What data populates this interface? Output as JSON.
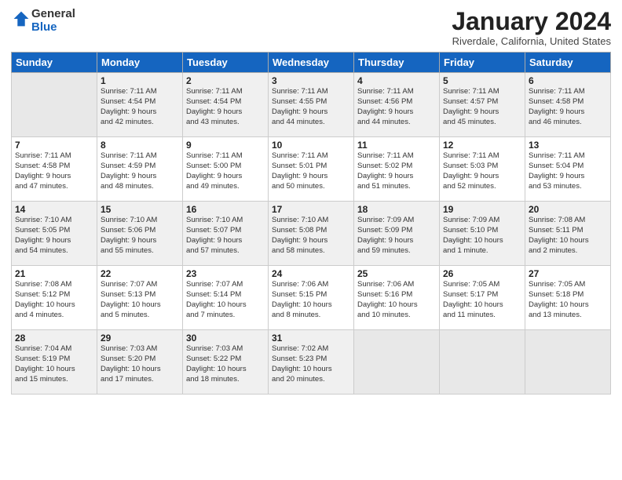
{
  "logo": {
    "text_general": "General",
    "text_blue": "Blue"
  },
  "header": {
    "month": "January 2024",
    "location": "Riverdale, California, United States"
  },
  "weekdays": [
    "Sunday",
    "Monday",
    "Tuesday",
    "Wednesday",
    "Thursday",
    "Friday",
    "Saturday"
  ],
  "weeks": [
    [
      {
        "day": "",
        "info": ""
      },
      {
        "day": "1",
        "info": "Sunrise: 7:11 AM\nSunset: 4:54 PM\nDaylight: 9 hours\nand 42 minutes."
      },
      {
        "day": "2",
        "info": "Sunrise: 7:11 AM\nSunset: 4:54 PM\nDaylight: 9 hours\nand 43 minutes."
      },
      {
        "day": "3",
        "info": "Sunrise: 7:11 AM\nSunset: 4:55 PM\nDaylight: 9 hours\nand 44 minutes."
      },
      {
        "day": "4",
        "info": "Sunrise: 7:11 AM\nSunset: 4:56 PM\nDaylight: 9 hours\nand 44 minutes."
      },
      {
        "day": "5",
        "info": "Sunrise: 7:11 AM\nSunset: 4:57 PM\nDaylight: 9 hours\nand 45 minutes."
      },
      {
        "day": "6",
        "info": "Sunrise: 7:11 AM\nSunset: 4:58 PM\nDaylight: 9 hours\nand 46 minutes."
      }
    ],
    [
      {
        "day": "7",
        "info": "Sunrise: 7:11 AM\nSunset: 4:58 PM\nDaylight: 9 hours\nand 47 minutes."
      },
      {
        "day": "8",
        "info": "Sunrise: 7:11 AM\nSunset: 4:59 PM\nDaylight: 9 hours\nand 48 minutes."
      },
      {
        "day": "9",
        "info": "Sunrise: 7:11 AM\nSunset: 5:00 PM\nDaylight: 9 hours\nand 49 minutes."
      },
      {
        "day": "10",
        "info": "Sunrise: 7:11 AM\nSunset: 5:01 PM\nDaylight: 9 hours\nand 50 minutes."
      },
      {
        "day": "11",
        "info": "Sunrise: 7:11 AM\nSunset: 5:02 PM\nDaylight: 9 hours\nand 51 minutes."
      },
      {
        "day": "12",
        "info": "Sunrise: 7:11 AM\nSunset: 5:03 PM\nDaylight: 9 hours\nand 52 minutes."
      },
      {
        "day": "13",
        "info": "Sunrise: 7:11 AM\nSunset: 5:04 PM\nDaylight: 9 hours\nand 53 minutes."
      }
    ],
    [
      {
        "day": "14",
        "info": "Sunrise: 7:10 AM\nSunset: 5:05 PM\nDaylight: 9 hours\nand 54 minutes."
      },
      {
        "day": "15",
        "info": "Sunrise: 7:10 AM\nSunset: 5:06 PM\nDaylight: 9 hours\nand 55 minutes."
      },
      {
        "day": "16",
        "info": "Sunrise: 7:10 AM\nSunset: 5:07 PM\nDaylight: 9 hours\nand 57 minutes."
      },
      {
        "day": "17",
        "info": "Sunrise: 7:10 AM\nSunset: 5:08 PM\nDaylight: 9 hours\nand 58 minutes."
      },
      {
        "day": "18",
        "info": "Sunrise: 7:09 AM\nSunset: 5:09 PM\nDaylight: 9 hours\nand 59 minutes."
      },
      {
        "day": "19",
        "info": "Sunrise: 7:09 AM\nSunset: 5:10 PM\nDaylight: 10 hours\nand 1 minute."
      },
      {
        "day": "20",
        "info": "Sunrise: 7:08 AM\nSunset: 5:11 PM\nDaylight: 10 hours\nand 2 minutes."
      }
    ],
    [
      {
        "day": "21",
        "info": "Sunrise: 7:08 AM\nSunset: 5:12 PM\nDaylight: 10 hours\nand 4 minutes."
      },
      {
        "day": "22",
        "info": "Sunrise: 7:07 AM\nSunset: 5:13 PM\nDaylight: 10 hours\nand 5 minutes."
      },
      {
        "day": "23",
        "info": "Sunrise: 7:07 AM\nSunset: 5:14 PM\nDaylight: 10 hours\nand 7 minutes."
      },
      {
        "day": "24",
        "info": "Sunrise: 7:06 AM\nSunset: 5:15 PM\nDaylight: 10 hours\nand 8 minutes."
      },
      {
        "day": "25",
        "info": "Sunrise: 7:06 AM\nSunset: 5:16 PM\nDaylight: 10 hours\nand 10 minutes."
      },
      {
        "day": "26",
        "info": "Sunrise: 7:05 AM\nSunset: 5:17 PM\nDaylight: 10 hours\nand 11 minutes."
      },
      {
        "day": "27",
        "info": "Sunrise: 7:05 AM\nSunset: 5:18 PM\nDaylight: 10 hours\nand 13 minutes."
      }
    ],
    [
      {
        "day": "28",
        "info": "Sunrise: 7:04 AM\nSunset: 5:19 PM\nDaylight: 10 hours\nand 15 minutes."
      },
      {
        "day": "29",
        "info": "Sunrise: 7:03 AM\nSunset: 5:20 PM\nDaylight: 10 hours\nand 17 minutes."
      },
      {
        "day": "30",
        "info": "Sunrise: 7:03 AM\nSunset: 5:22 PM\nDaylight: 10 hours\nand 18 minutes."
      },
      {
        "day": "31",
        "info": "Sunrise: 7:02 AM\nSunset: 5:23 PM\nDaylight: 10 hours\nand 20 minutes."
      },
      {
        "day": "",
        "info": ""
      },
      {
        "day": "",
        "info": ""
      },
      {
        "day": "",
        "info": ""
      }
    ]
  ]
}
